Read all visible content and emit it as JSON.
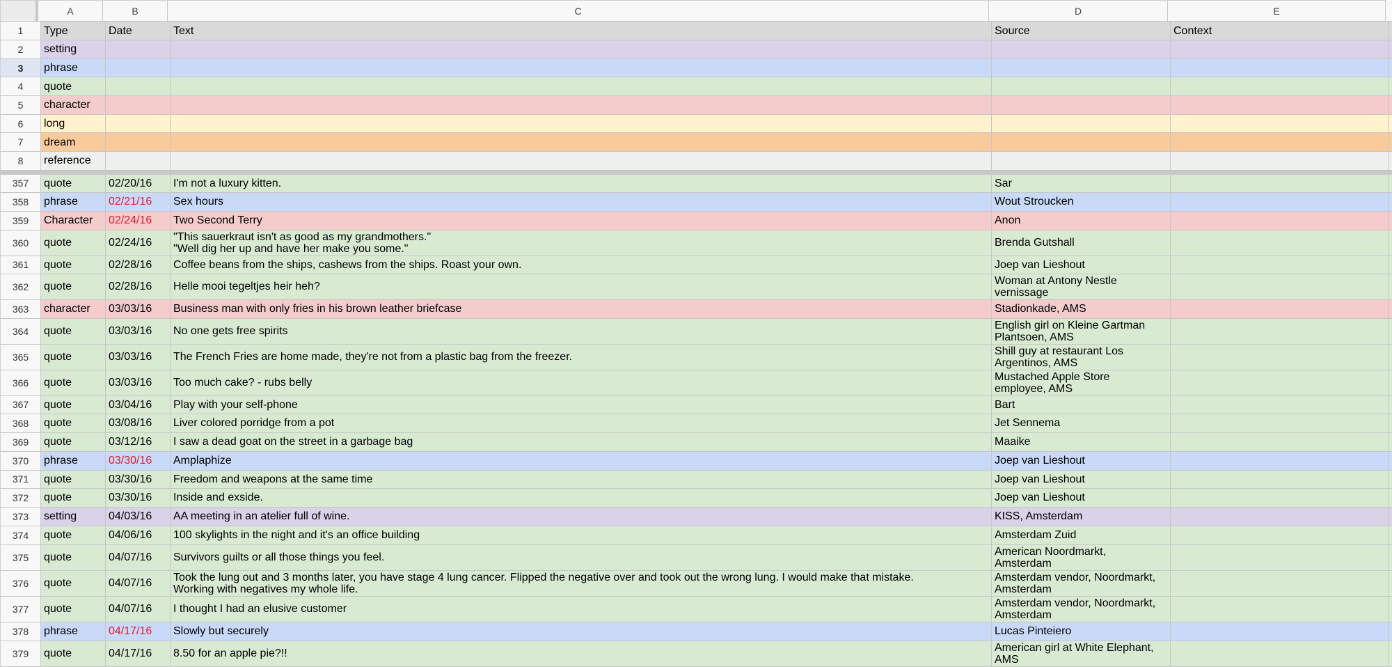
{
  "columns": [
    "A",
    "B",
    "C",
    "D",
    "E"
  ],
  "colors": {
    "setting": "#d9d2e9",
    "phrase": "#c9daf8",
    "quote": "#d9ead3",
    "character": "#f4cccc",
    "long": "#fff2cc",
    "dream": "#f9cb9c",
    "reference": "#efefef",
    "header": "#d9d9d9",
    "red_date": "#e0182e"
  },
  "header_row": {
    "num": "1",
    "cells": [
      "Type",
      "Date",
      "Text",
      "Source",
      "Context"
    ]
  },
  "legend_rows": [
    {
      "num": "2",
      "type": "setting",
      "cat": "setting"
    },
    {
      "num": "3",
      "type": "phrase",
      "cat": "phrase",
      "selected": true
    },
    {
      "num": "4",
      "type": "quote",
      "cat": "quote"
    },
    {
      "num": "5",
      "type": "character",
      "cat": "character"
    },
    {
      "num": "6",
      "type": "long",
      "cat": "long"
    },
    {
      "num": "7",
      "type": "dream",
      "cat": "dream"
    },
    {
      "num": "8",
      "type": "reference",
      "cat": "reference"
    }
  ],
  "data_rows": [
    {
      "num": "357",
      "type": "quote",
      "date": "02/20/16",
      "text": "I'm not a luxury kitten.",
      "source": "Sar",
      "context": "",
      "cat": "quote",
      "red": false,
      "h": 26
    },
    {
      "num": "358",
      "type": "phrase",
      "date": "02/21/16",
      "text": "Sex hours",
      "source": "Wout Stroucken",
      "context": "",
      "cat": "phrase",
      "red": true,
      "h": 27
    },
    {
      "num": "359",
      "type": "Character",
      "date": "02/24/16",
      "text": "Two Second Terry",
      "source": "Anon",
      "context": "",
      "cat": "character",
      "red": true,
      "h": 27
    },
    {
      "num": "360",
      "type": "quote",
      "date": "02/24/16",
      "text": "\"This sauerkraut isn't as good as my grandmothers.\"\n\"Well dig her up and have her make you some.\"",
      "source": "Brenda Gutshall",
      "context": "",
      "cat": "quote",
      "red": false,
      "h": 37
    },
    {
      "num": "361",
      "type": "quote",
      "date": "02/28/16",
      "text": "Coffee beans from the ships, cashews from the ships. Roast your own.",
      "source": "Joep van Lieshout",
      "context": "",
      "cat": "quote",
      "red": false,
      "h": 26
    },
    {
      "num": "362",
      "type": "quote",
      "date": "02/28/16",
      "text": "Helle mooi tegeltjes heir heh?",
      "source": "Woman at Antony Nestle\nvernissage",
      "context": "",
      "cat": "quote",
      "red": false,
      "h": 37
    },
    {
      "num": "363",
      "type": "character",
      "date": "03/03/16",
      "text": "Business man with only fries in his brown leather briefcase",
      "source": "Stadionkade, AMS",
      "context": "",
      "cat": "character",
      "red": false,
      "h": 27
    },
    {
      "num": "364",
      "type": "quote",
      "date": "03/03/16",
      "text": "No one gets free spirits",
      "source": "English girl on Kleine Gartman\nPlantsoen, AMS",
      "context": "",
      "cat": "quote",
      "red": false,
      "h": 37
    },
    {
      "num": "365",
      "type": "quote",
      "date": "03/03/16",
      "text": "The French Fries are home made, they're not from a plastic bag from the freezer.",
      "source": "Shill guy at restaurant Los\nArgentinos, AMS",
      "context": "",
      "cat": "quote",
      "red": false,
      "h": 37
    },
    {
      "num": "366",
      "type": "quote",
      "date": "03/03/16",
      "text": "Too much cake? - rubs belly",
      "source": "Mustached Apple Store\nemployee, AMS",
      "context": "",
      "cat": "quote",
      "red": false,
      "h": 37
    },
    {
      "num": "367",
      "type": "quote",
      "date": "03/04/16",
      "text": "Play with your self-phone",
      "source": "Bart",
      "context": "",
      "cat": "quote",
      "red": false,
      "h": 26
    },
    {
      "num": "368",
      "type": "quote",
      "date": "03/08/16",
      "text": "Liver colored porridge from a pot",
      "source": "Jet Sennema",
      "context": "",
      "cat": "quote",
      "red": false,
      "h": 27
    },
    {
      "num": "369",
      "type": "quote",
      "date": "03/12/16",
      "text": "I saw a dead goat on the street in a garbage bag",
      "source": "Maaike",
      "context": "",
      "cat": "quote",
      "red": false,
      "h": 27
    },
    {
      "num": "370",
      "type": "phrase",
      "date": "03/30/16",
      "text": "Amplaphize",
      "source": "Joep van Lieshout",
      "context": "",
      "cat": "phrase",
      "red": true,
      "h": 27
    },
    {
      "num": "371",
      "type": "quote",
      "date": "03/30/16",
      "text": "Freedom and weapons at the same time",
      "source": "Joep van Lieshout",
      "context": "",
      "cat": "quote",
      "red": false,
      "h": 26
    },
    {
      "num": "372",
      "type": "quote",
      "date": "03/30/16",
      "text": "Inside and exside.",
      "source": "Joep van Lieshout",
      "context": "",
      "cat": "quote",
      "red": false,
      "h": 27
    },
    {
      "num": "373",
      "type": "setting",
      "date": "04/03/16",
      "text": "AA meeting in an atelier full of wine.",
      "source": "KISS, Amsterdam",
      "context": "",
      "cat": "setting",
      "red": false,
      "h": 27
    },
    {
      "num": "374",
      "type": "quote",
      "date": "04/06/16",
      "text": "100 skylights in the night and it's an office building",
      "source": "Amsterdam Zuid",
      "context": "",
      "cat": "quote",
      "red": false,
      "h": 27
    },
    {
      "num": "375",
      "type": "quote",
      "date": "04/07/16",
      "text": "Survivors guilts or all those things you feel.",
      "source": "American Noordmarkt,\nAmsterdam",
      "context": "",
      "cat": "quote",
      "red": false,
      "h": 37
    },
    {
      "num": "376",
      "type": "quote",
      "date": "04/07/16",
      "text": "Took the lung out and 3 months later, you have stage 4 lung cancer. Flipped the negative over and took out the wrong lung. I would make that mistake.\nWorking with negatives my whole life.",
      "source": "Amsterdam vendor, Noordmarkt,\nAmsterdam",
      "context": "",
      "cat": "quote",
      "red": false,
      "h": 37
    },
    {
      "num": "377",
      "type": "quote",
      "date": "04/07/16",
      "text": "I thought I had an elusive customer",
      "source": "Amsterdam vendor, Noordmarkt,\nAmsterdam",
      "context": "",
      "cat": "quote",
      "red": false,
      "h": 37
    },
    {
      "num": "378",
      "type": "phrase",
      "date": "04/17/16",
      "text": "Slowly but securely",
      "source": "Lucas Pinteiero",
      "context": "",
      "cat": "phrase",
      "red": true,
      "h": 27
    },
    {
      "num": "379",
      "type": "quote",
      "date": "04/17/16",
      "text": "8.50 for an apple pie?!!",
      "source": "American girl at White Elephant,\nAMS",
      "context": "",
      "cat": "quote",
      "red": false,
      "h": 37
    }
  ]
}
